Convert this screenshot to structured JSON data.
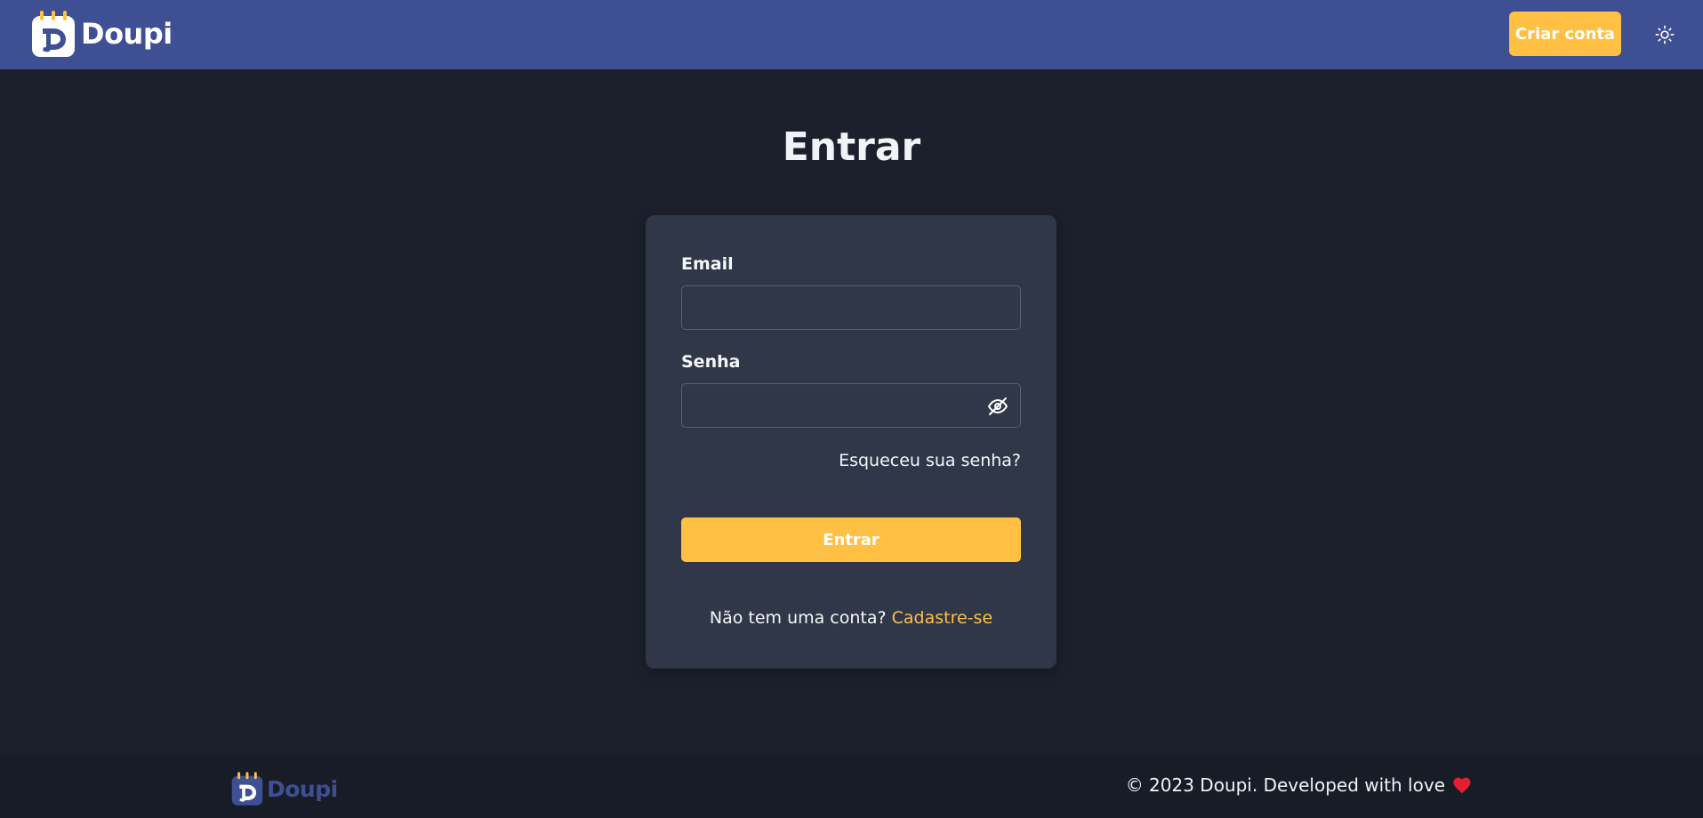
{
  "header": {
    "brand": "Doupi",
    "create_account_label": "Criar conta",
    "theme_icon": "sun-icon"
  },
  "main": {
    "title": "Entrar",
    "email_label": "Email",
    "email_value": "",
    "password_label": "Senha",
    "password_value": "",
    "password_toggle_icon": "eye-off-icon",
    "forgot_password": "Esqueceu sua senha?",
    "login_button": "Entrar",
    "no_account_text": "Não tem uma conta?",
    "signup_link": "Cadastre-se"
  },
  "footer": {
    "brand": "Doupi",
    "copyright": "© 2023 Doupi. Developed with love",
    "heart_icon": "heart-icon"
  },
  "colors": {
    "header_bg": "#3f4f93",
    "page_bg": "#1b202c",
    "card_bg": "#2f3748",
    "accent": "#ffc043",
    "footer_bg": "#181c26"
  }
}
